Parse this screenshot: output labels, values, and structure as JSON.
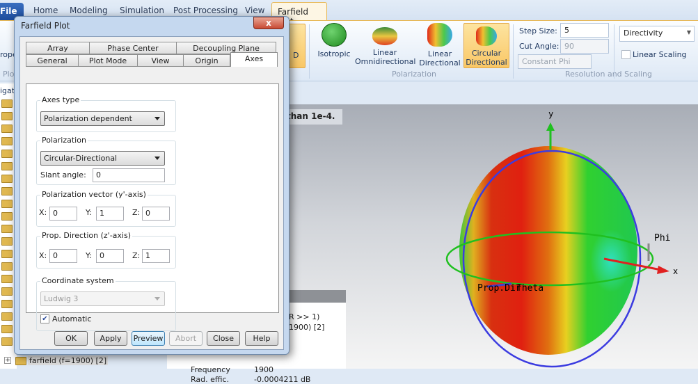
{
  "menu": {
    "file": "File",
    "tabs": [
      "Home",
      "Modeling",
      "Simulation",
      "Post Processing",
      "View"
    ],
    "active_tab": "Farfield Plot"
  },
  "ribbon": {
    "left_partial": {
      "button": "rope",
      "group": "Plo",
      "nav": "igati"
    },
    "d_button": "D",
    "polarization": {
      "buttons": [
        "Isotropic",
        "Linear Omnidirectional",
        "Linear Directional",
        "Circular Directional"
      ],
      "selected": "Circular Directional",
      "group": "Polarization"
    },
    "resolution": {
      "step_size_label": "Step Size:",
      "step_size": "5",
      "cut_angle_label": "Cut Angle:",
      "cut_angle": "90",
      "cut_type": "Constant Phi",
      "group": "Resolution and Scaling"
    },
    "quantity": "Directivity",
    "linear_scaling": "Linear Scaling",
    "linear_scaling_checked": false
  },
  "notice": "than 1e-4.",
  "tree": {
    "item": "farfield (f=1900) [2]",
    "expand": "+"
  },
  "info_panel": {
    "lines": [
      "R >> 1)",
      "1900) [2]"
    ],
    "frequency_label": "Frequency",
    "frequency": "1900",
    "rad_effic_label": "Rad. effic.",
    "rad_effic": "-0.0004211 dB"
  },
  "plot": {
    "axis_y": "y",
    "axis_x": "x",
    "phi": "Phi",
    "theta": "Theta",
    "prop": "Prop.Dir"
  },
  "dialog": {
    "title": "Farfield Plot",
    "close": "x",
    "tabs_row1": [
      "Array",
      "Phase Center",
      "Decoupling Plane"
    ],
    "tabs_row2": [
      "General",
      "Plot Mode",
      "View",
      "Origin",
      "Axes"
    ],
    "active_tab": "Axes",
    "axes_type": {
      "label": "Axes type",
      "value": "Polarization dependent"
    },
    "polarization": {
      "label": "Polarization",
      "value": "Circular-Directional",
      "slant_label": "Slant angle:",
      "slant": "0"
    },
    "pol_vector": {
      "label": "Polarization vector (y'-axis)",
      "x_label": "X:",
      "x": "0",
      "y_label": "Y:",
      "y": "1",
      "z_label": "Z:",
      "z": "0"
    },
    "prop_dir": {
      "label": "Prop. Direction (z'-axis)",
      "x_label": "X:",
      "x": "0",
      "y_label": "Y:",
      "y": "0",
      "z_label": "Z:",
      "z": "1"
    },
    "coord": {
      "label": "Coordinate system",
      "value": "Ludwig 3",
      "automatic": "Automatic",
      "automatic_checked": true
    },
    "buttons": [
      "OK",
      "Apply",
      "Preview",
      "Abort",
      "Close",
      "Help"
    ]
  }
}
